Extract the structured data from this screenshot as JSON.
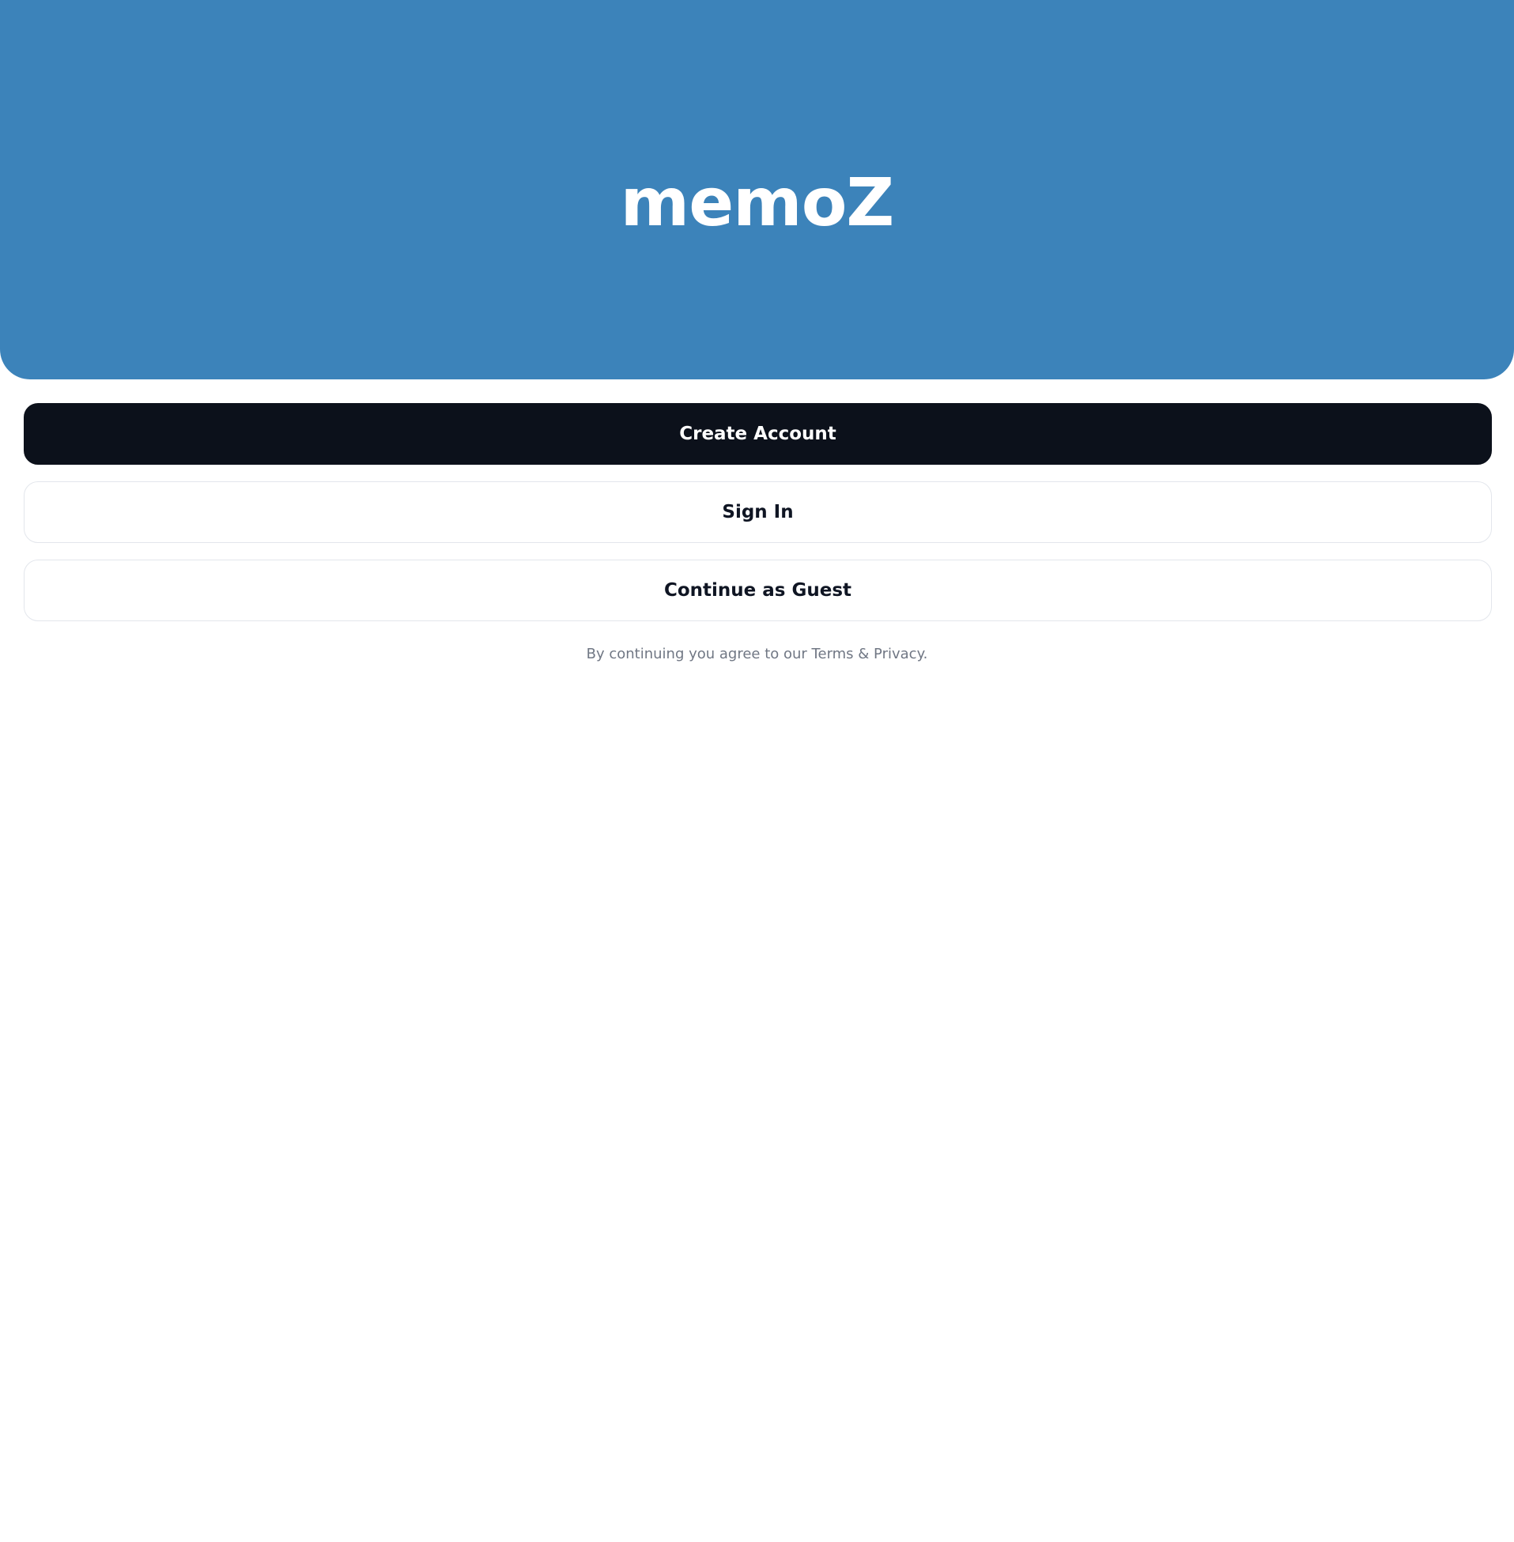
{
  "hero": {
    "title": "memoZ",
    "background_color": "#3c83ba"
  },
  "actions": {
    "create_account_label": "Create Account",
    "sign_in_label": "Sign In",
    "guest_label": "Continue as Guest"
  },
  "footer": {
    "terms_text": "By continuing you agree to our Terms & Privacy."
  },
  "colors": {
    "primary_button": "#0c111b",
    "outline_border": "#e3e6ec",
    "muted_text": "#707784"
  }
}
